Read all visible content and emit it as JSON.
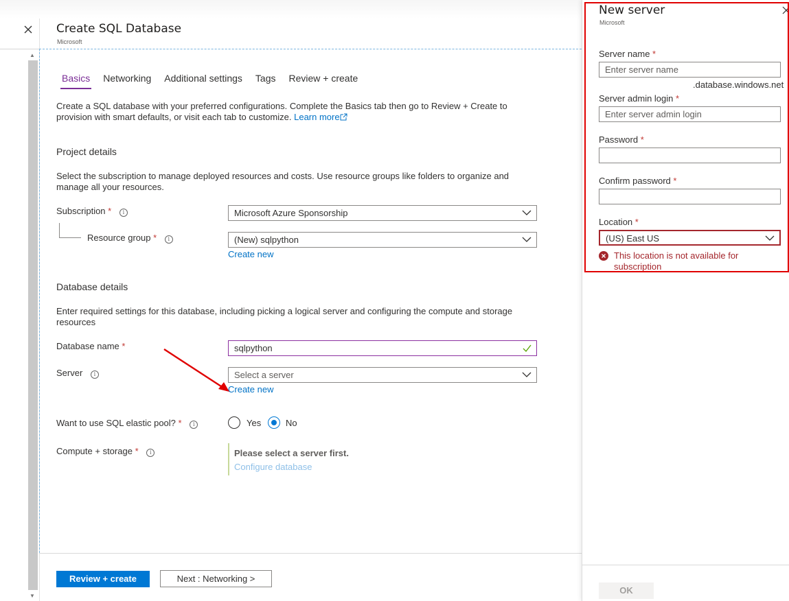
{
  "main": {
    "title": "Create SQL Database",
    "subtitle": "Microsoft",
    "tabs": [
      {
        "label": "Basics",
        "active": true
      },
      {
        "label": "Networking"
      },
      {
        "label": "Additional settings"
      },
      {
        "label": "Tags"
      },
      {
        "label": "Review + create"
      }
    ],
    "intro_text": "Create a SQL database with your preferred configurations. Complete the Basics tab then go to Review + Create to provision with smart defaults, or visit each tab to customize.",
    "learn_more": "Learn more",
    "project": {
      "heading": "Project details",
      "description": "Select the subscription to manage deployed resources and costs. Use resource groups like folders to organize and manage all your resources.",
      "subscription_label": "Subscription",
      "subscription_value": "Microsoft Azure Sponsorship",
      "resource_group_label": "Resource group",
      "resource_group_value": "(New) sqlpython",
      "create_new": "Create new"
    },
    "database": {
      "heading": "Database details",
      "description": "Enter required settings for this database, including picking a logical server and configuring the compute and storage resources",
      "name_label": "Database name",
      "name_value": "sqlpython",
      "server_label": "Server",
      "server_placeholder": "Select a server",
      "create_new": "Create new",
      "elastic_label": "Want to use SQL elastic pool?",
      "elastic_yes": "Yes",
      "elastic_no": "No",
      "elastic_selected": "No",
      "compute_label": "Compute + storage",
      "compute_note": "Please select a server first.",
      "compute_link": "Configure database"
    },
    "required_marker": "*",
    "buttons": {
      "review": "Review + create",
      "next": "Next : Networking >"
    }
  },
  "panel": {
    "title": "New server",
    "subtitle": "Microsoft",
    "server_name_label": "Server name",
    "server_name_placeholder": "Enter server name",
    "suffix": ".database.windows.net",
    "admin_label": "Server admin login",
    "admin_placeholder": "Enter server admin login",
    "password_label": "Password",
    "confirm_label": "Confirm password",
    "location_label": "Location",
    "location_value": "(US) East US",
    "error_text": "This location is not available for subscription",
    "ok": "OK"
  },
  "colors": {
    "accent": "#0078d4",
    "tab_active": "#7a2d96",
    "error": "#a4262c",
    "highlight": "#e00000"
  }
}
